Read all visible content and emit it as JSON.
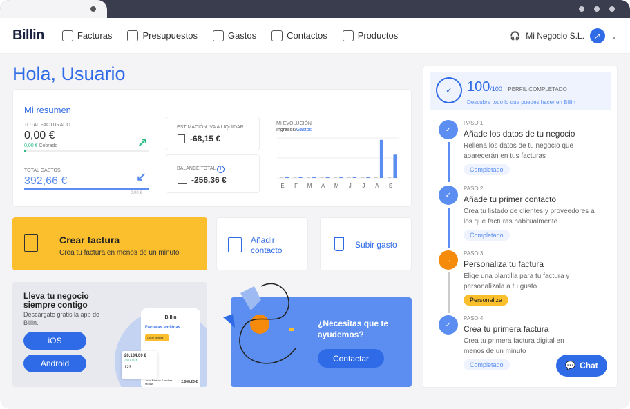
{
  "nav": {
    "logo": "Billin",
    "items": [
      {
        "label": "Facturas",
        "icon": "invoice-icon"
      },
      {
        "label": "Presupuestos",
        "icon": "quote-icon"
      },
      {
        "label": "Gastos",
        "icon": "cup-icon"
      },
      {
        "label": "Contactos",
        "icon": "contacts-icon"
      },
      {
        "label": "Productos",
        "icon": "box-icon"
      }
    ],
    "business": "Mi Negocio S.L."
  },
  "greeting": "Hola, Usuario",
  "summary": {
    "title": "Mi resumen",
    "facturado_label": "TOTAL FACTURADO",
    "facturado": "0,00 €",
    "cobrado_value": "0,00 €",
    "cobrado_label": "Cobrado",
    "gastos_label": "TOTAL GASTOS",
    "gastos": "392,66 €",
    "gastos_sub": "0,00 €",
    "iva_label": "ESTIMACIÓN IVA A LIQUIDAR",
    "iva": "-68,15 €",
    "balance_label": "BALANCE TOTAL",
    "balance": "-256,36 €",
    "evo_label": "MI EVOLUCIÓN",
    "evo_ingresos": "Ingresos",
    "evo_gastos": "Gastos"
  },
  "chart_data": {
    "type": "bar",
    "categories": [
      "E",
      "F",
      "M",
      "A",
      "M",
      "J",
      "J",
      "A",
      "S"
    ],
    "series": [
      {
        "name": "Ingresos",
        "values": [
          0,
          0,
          0,
          0,
          0,
          0,
          0,
          0,
          0
        ]
      },
      {
        "name": "Gastos",
        "values": [
          0,
          0,
          0,
          0,
          0,
          0,
          0,
          244,
          149
        ]
      }
    ],
    "grid": true,
    "colors": {
      "Ingresos": "#cccccc",
      "Gastos": "#5b8ef0"
    }
  },
  "actions": {
    "crear_title": "Crear factura",
    "crear_sub": "Crea tu factura en menos de un minuto",
    "contacto": "Añadir contacto",
    "gasto": "Subir gasto"
  },
  "app_promo": {
    "title": "Lleva tu negocio siempre contigo",
    "sub": "Descárgate gratis la app de Billin.",
    "ios": "iOS",
    "android": "Android",
    "mock_logo": "Billin",
    "mock_title": "Facturas emitidas",
    "mock_btn": "Crear factura",
    "mock_amount": "20.134,00 €",
    "mock_green": "7.675,00 €",
    "mock_count": "123",
    "mock_name": "Juan Ramón Sánchez Molina",
    "mock_value": "2.008,23 €"
  },
  "help": {
    "title": "¿Necesitas que te ayudemos?",
    "button": "Contactar"
  },
  "profile": {
    "score": "100",
    "max": "/100",
    "label": "PERFIL COMPLETADO",
    "link": "Descubre todo lo que puedes hacer en Billin",
    "steps": [
      {
        "paso": "PASO 1",
        "title": "Añade los datos de tu negocio",
        "desc": "Rellena los datos de tu negocio que aparecerán en tus facturas",
        "badge": "Completado"
      },
      {
        "paso": "PASO 2",
        "title": "Añade tu primer contacto",
        "desc": "Crea tu listado de clientes y proveedores a los que facturas habitualmente",
        "badge": "Completado"
      },
      {
        "paso": "PASO 3",
        "title": "Personaliza tu factura",
        "desc": "Elige una plantilla para tu factura y personalízala a tu gusto",
        "badge": "Personaliza"
      },
      {
        "paso": "PASO 4",
        "title": "Crea tu primera factura",
        "desc": "Crea tu primera factura digital en menos de un minuto",
        "badge": "Completado"
      }
    ]
  },
  "chat": "Chat",
  "colors": {
    "accent": "#2f6be6",
    "yellow": "#fbbf2e",
    "orange": "#f58a0b",
    "green": "#2ebd85"
  }
}
